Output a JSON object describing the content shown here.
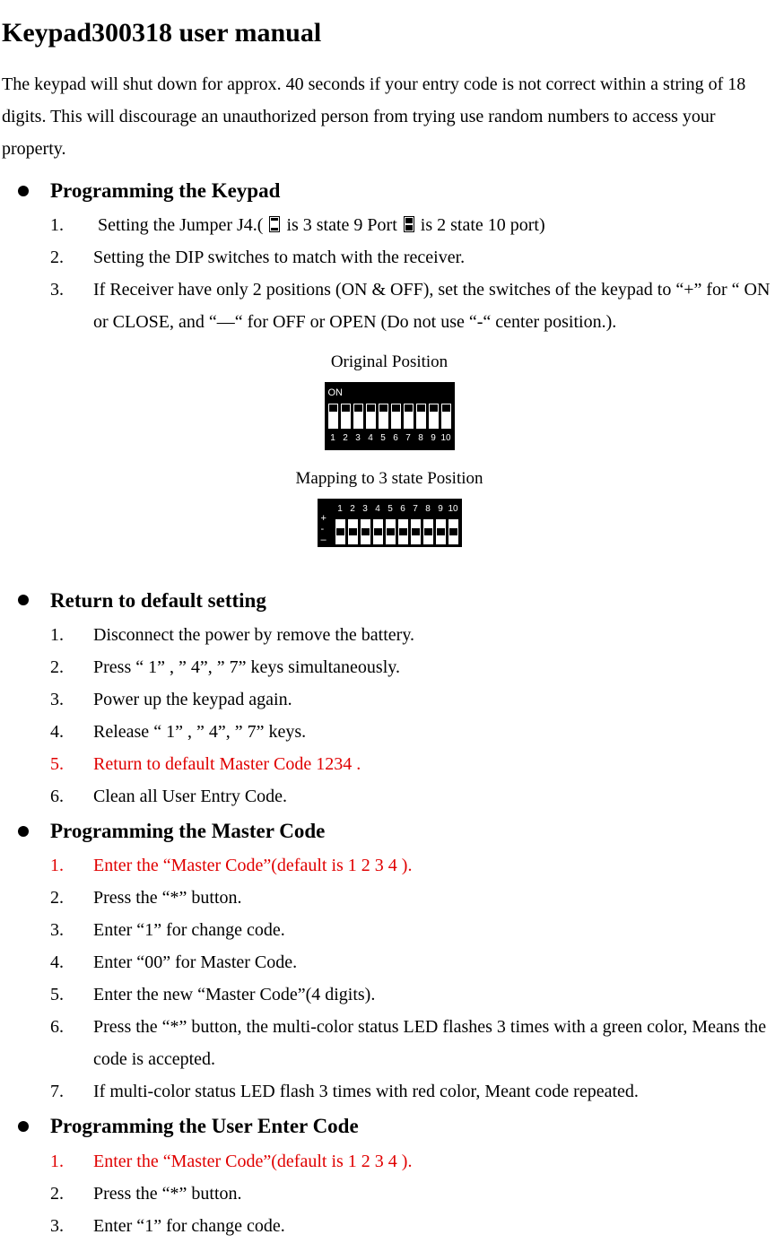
{
  "title": "Keypad300318 user manual",
  "intro": "The keypad will shut down for approx. 40 seconds if your entry code is not correct within a string of 18 digits. This will discourage an unauthorized person from trying use random numbers to access your property.",
  "sections": [
    {
      "heading": "Programming the Keypad",
      "items": [
        {
          "text_parts": [
            "Setting the Jumper J4.(  ",
            "ICON3",
            " is 3 state 9 Port  ",
            "ICON2",
            " is 2 state 10 port)"
          ]
        },
        {
          "text": "Setting the DIP switches to match with the receiver."
        },
        {
          "text": "If Receiver have only 2 positions (ON & OFF), set the switches of the keypad to “+” for “ ON or CLOSE, and “—“ for OFF or OPEN (Do not use “-“ center position.)."
        }
      ],
      "figure": {
        "label1": "Original Position",
        "label2": "Mapping to 3 state Position",
        "on_label": "ON",
        "numbers": [
          "1",
          "2",
          "3",
          "4",
          "5",
          "6",
          "7",
          "8",
          "9",
          "10"
        ],
        "side_plus": "+",
        "side_mid": "-",
        "side_minus": "–"
      }
    },
    {
      "heading": "Return to default setting",
      "items": [
        {
          "text": "Disconnect the power by remove the battery."
        },
        {
          "text": "Press “ 1” , ” 4”, ” 7” keys simultaneously."
        },
        {
          "text": "Power up the keypad again."
        },
        {
          "text": "Release “ 1” , ” 4”, ” 7” keys."
        },
        {
          "text": "Return to default Master Code 1234 .",
          "red": true
        },
        {
          "text": "Clean all User Entry Code."
        }
      ]
    },
    {
      "heading": "Programming the Master Code",
      "items": [
        {
          "text": "Enter the “Master Code”(default is    1 2 3 4    ).",
          "red": true
        },
        {
          "text": "Press the “*” button."
        },
        {
          "text": "Enter “1” for change code."
        },
        {
          "text": "Enter “00” for Master Code."
        },
        {
          "text": "Enter the new “Master Code”(4 digits)."
        },
        {
          "text": "Press the “*” button, the multi-color status LED flashes 3 times with a green color, Means the code is accepted."
        },
        {
          "text": "If multi-color status LED flash 3 times with red color, Meant code repeated."
        }
      ]
    },
    {
      "heading": "Programming the User Enter Code",
      "items": [
        {
          "text": "Enter the “Master Code”(default is    1 2 3 4    ).",
          "red": true
        },
        {
          "text": "Press the “*” button."
        },
        {
          "text": "Enter “1” for change code."
        }
      ]
    }
  ]
}
